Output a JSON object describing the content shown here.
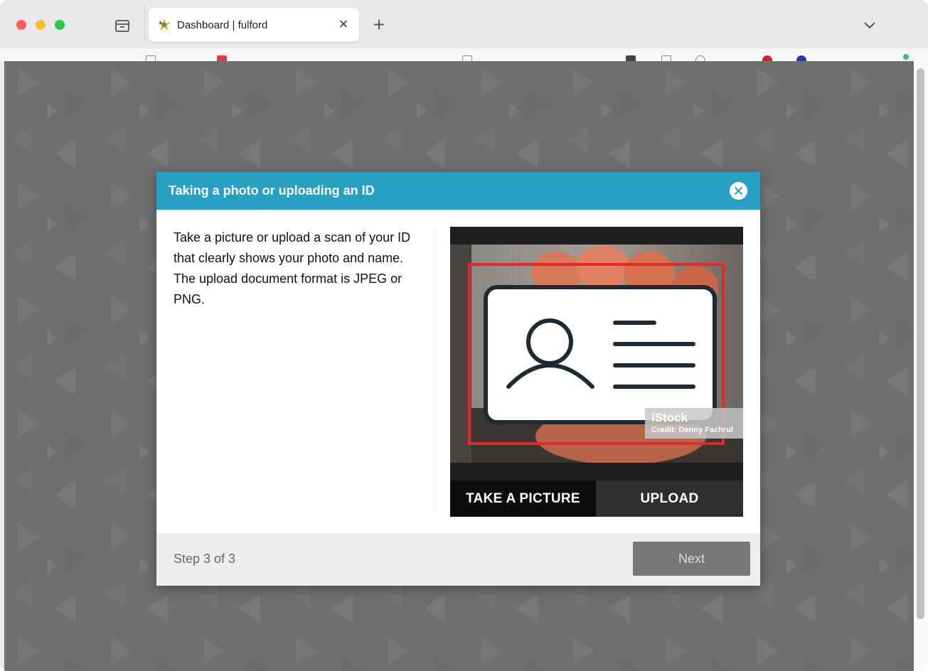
{
  "browser": {
    "tab": {
      "title": "Dashboard | fulford",
      "favicon": "fulford-logo-icon"
    },
    "icons": {
      "tab_overview": "tab-overview-icon",
      "new_tab": "+",
      "close_tab": "×",
      "tab_list": "chevron-down-icon"
    }
  },
  "modal": {
    "title": "Taking a photo or uploading an ID",
    "close_icon": "close-circle-icon",
    "instructions": "Take a picture or upload a scan of your ID that clearly shows your photo and name. The upload document format is JPEG or PNG.",
    "camera": {
      "watermark_logo": "iStock",
      "watermark_credit": "Credit: Denny Fachrul",
      "take_picture_label": "TAKE A PICTURE",
      "upload_label": "UPLOAD"
    },
    "footer": {
      "step_text": "Step 3 of 3",
      "next_label": "Next"
    }
  },
  "colors": {
    "modal_header": "#27a0c4",
    "frame_outline": "#e22a2a",
    "next_button_disabled": "#777777"
  }
}
